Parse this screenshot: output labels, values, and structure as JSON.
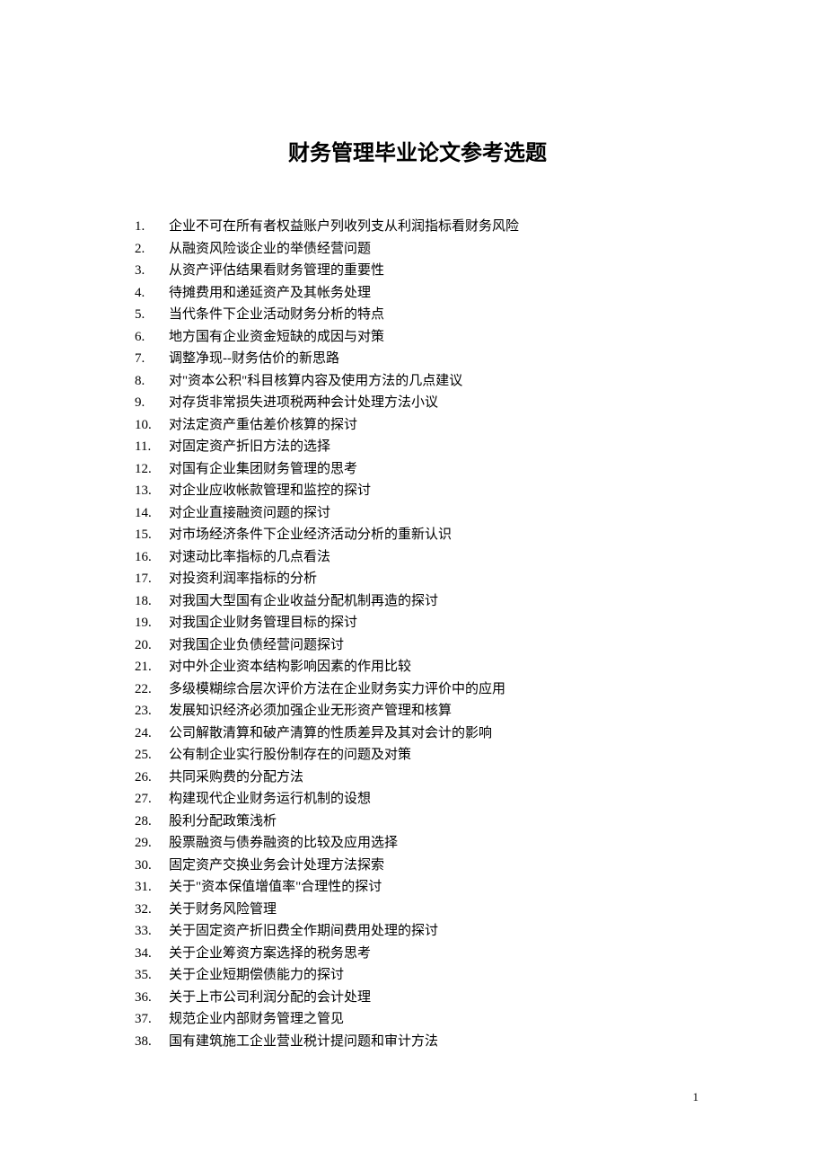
{
  "title": "财务管理毕业论文参考选题",
  "items": [
    "企业不可在所有者权益账户列收列支从利润指标看财务风险",
    "从融资风险谈企业的举债经营问题",
    "从资产评估结果看财务管理的重要性",
    "待摊费用和递延资产及其帐务处理",
    "当代条件下企业活动财务分析的特点",
    "地方国有企业资金短缺的成因与对策",
    "调整净现--财务估价的新思路",
    "对\"资本公积\"科目核算内容及使用方法的几点建议",
    "对存货非常损失进项税两种会计处理方法小议",
    "对法定资产重估差价核算的探讨",
    "对固定资产折旧方法的选择",
    "对国有企业集团财务管理的思考",
    "对企业应收帐款管理和监控的探讨",
    "对企业直接融资问题的探讨",
    "对市场经济条件下企业经济活动分析的重新认识",
    "对速动比率指标的几点看法",
    "对投资利润率指标的分析",
    "对我国大型国有企业收益分配机制再造的探讨",
    "对我国企业财务管理目标的探讨",
    "对我国企业负债经营问题探讨",
    "对中外企业资本结构影响因素的作用比较",
    "多级模糊综合层次评价方法在企业财务实力评价中的应用",
    "发展知识经济必须加强企业无形资产管理和核算",
    "公司解散清算和破产清算的性质差异及其对会计的影响",
    "公有制企业实行股份制存在的问题及对策",
    "共同采购费的分配方法",
    "构建现代企业财务运行机制的设想",
    "股利分配政策浅析",
    "股票融资与债券融资的比较及应用选择",
    "固定资产交换业务会计处理方法探索",
    "关于\"资本保值增值率\"合理性的探讨",
    "关于财务风险管理",
    "关于固定资产折旧费全作期间费用处理的探讨",
    "关于企业筹资方案选择的税务思考",
    "关于企业短期偿债能力的探讨",
    "关于上市公司利润分配的会计处理",
    "规范企业内部财务管理之管见",
    "国有建筑施工企业营业税计提问题和审计方法"
  ],
  "pageNumber": "1"
}
